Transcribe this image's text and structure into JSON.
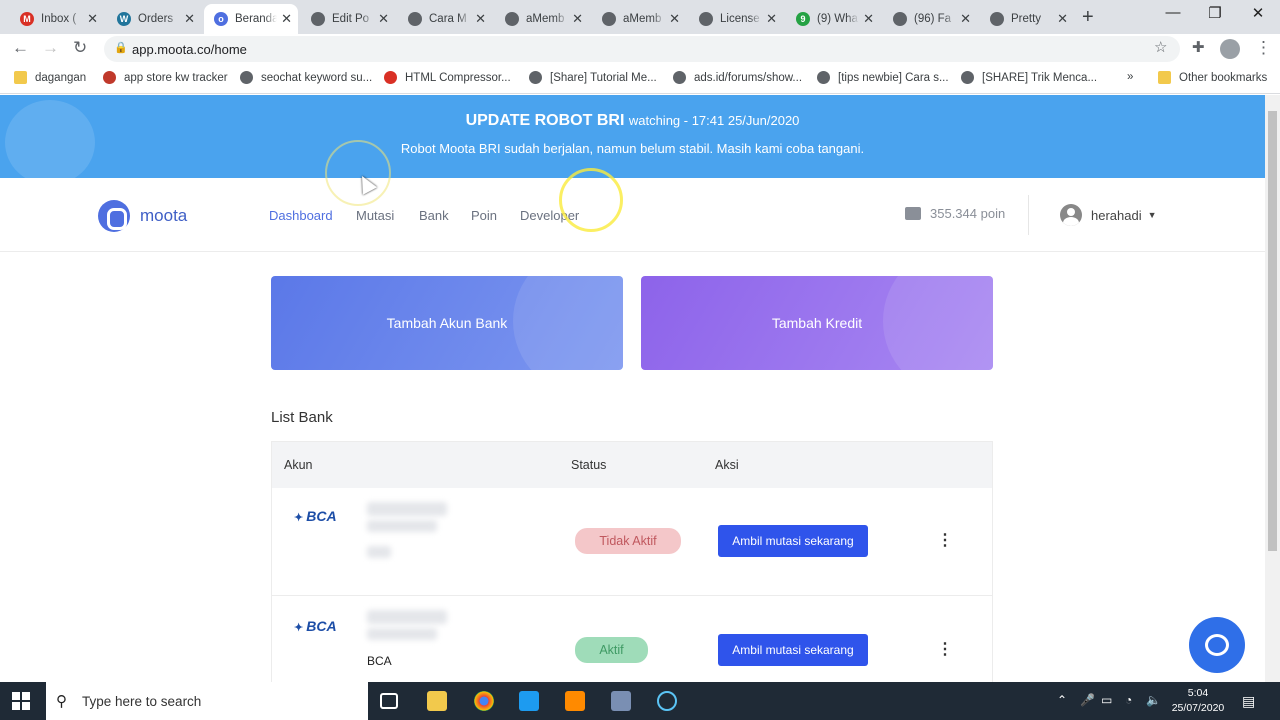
{
  "browser": {
    "tabs": [
      {
        "title": "Inbox (",
        "icon": "gmail-icon",
        "color": "#d93025",
        "glyph": "M"
      },
      {
        "title": "Orders",
        "icon": "wordpress-icon",
        "color": "#21759b",
        "glyph": "W"
      },
      {
        "title": "Beranda",
        "icon": "moota-icon",
        "color": "#4f6fe0",
        "glyph": "o"
      },
      {
        "title": "Edit Po",
        "icon": "globe-icon",
        "color": "#5f6368",
        "glyph": ""
      },
      {
        "title": "Cara M",
        "icon": "globe-icon",
        "color": "#5f6368",
        "glyph": ""
      },
      {
        "title": "aMemb",
        "icon": "globe-icon",
        "color": "#5f6368",
        "glyph": ""
      },
      {
        "title": "aMemb",
        "icon": "globe-icon",
        "color": "#5f6368",
        "glyph": ""
      },
      {
        "title": "License",
        "icon": "globe-icon",
        "color": "#5f6368",
        "glyph": ""
      },
      {
        "title": "(9) Wha",
        "icon": "whatsapp-icon",
        "color": "#25a244",
        "glyph": "9"
      },
      {
        "title": "(96) Fa",
        "icon": "page-icon",
        "color": "#5f6368",
        "glyph": ""
      },
      {
        "title": "Pretty",
        "icon": "globe-icon",
        "color": "#5f6368",
        "glyph": ""
      }
    ],
    "active_tab": 2,
    "url": "app.moota.co/home",
    "bookmarks": [
      {
        "label": "dagangan",
        "icon": "folder-icon"
      },
      {
        "label": "app store kw tracker",
        "icon": "flame-icon"
      },
      {
        "label": "seochat keyword su...",
        "icon": "globe-icon"
      },
      {
        "label": "HTML Compressor...",
        "icon": "compressor-icon"
      },
      {
        "label": "[Share] Tutorial Me...",
        "icon": "kaskus-icon"
      },
      {
        "label": "ads.id/forums/show...",
        "icon": "kaskus-icon"
      },
      {
        "label": "[tips newbie] Cara s...",
        "icon": "kaskus-icon"
      },
      {
        "label": "[SHARE] Trik Menca...",
        "icon": "kaskus-icon"
      }
    ],
    "overflow": "»",
    "other_bookmarks": "Other bookmarks"
  },
  "banner": {
    "title": "UPDATE ROBOT BRI",
    "watching": "watching - 17:41 25/Jun/2020",
    "message": "Robot Moota BRI sudah berjalan, namun belum stabil. Masih kami coba tangani."
  },
  "nav": {
    "brand": "moota",
    "items": [
      "Dashboard",
      "Mutasi",
      "Bank",
      "Poin",
      "Developer"
    ],
    "points": "355.344 poin",
    "user": "herahadi"
  },
  "cards": {
    "add_bank": "Tambah Akun Bank",
    "add_credit": "Tambah Kredit"
  },
  "list": {
    "title": "List Bank",
    "columns": [
      "Akun",
      "Status",
      "Aksi"
    ],
    "rows": [
      {
        "bank": "BCA",
        "name": "",
        "status": "Tidak Aktif",
        "action": "Ambil mutasi sekarang"
      },
      {
        "bank": "BCA",
        "name": "BCA",
        "status": "Aktif",
        "action": "Ambil mutasi sekarang"
      }
    ]
  },
  "taskbar": {
    "search_placeholder": "Type here to search",
    "time": "5:04",
    "date": "25/07/2020"
  },
  "colors": {
    "banner": "#4aa3ee",
    "primary": "#2f54eb",
    "card_bank": "#5b78e8",
    "card_credit": "#8d63ea"
  }
}
